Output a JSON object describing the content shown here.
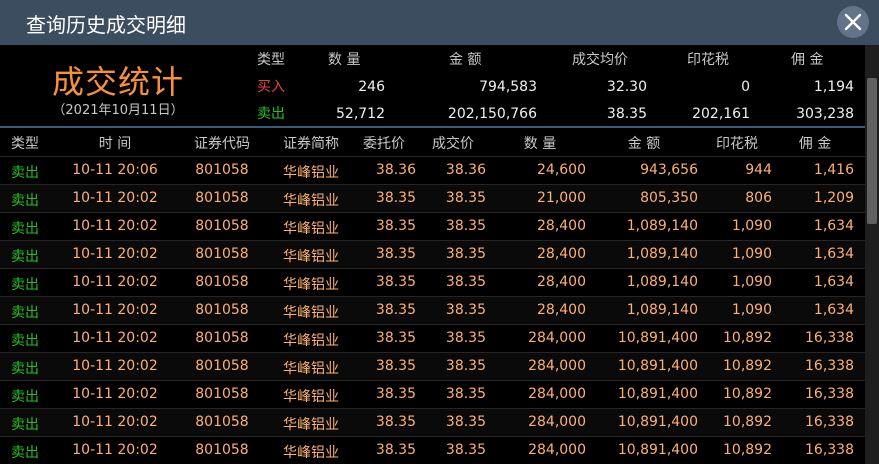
{
  "window": {
    "title": "查询历史成交明细",
    "close_icon": "close-icon"
  },
  "colors": {
    "titlebar": "#3c4d5f",
    "accent_orange": "#f7923a",
    "buy_red": "#e8413b",
    "sell_green": "#26c026",
    "cell_orange": "#ffb070",
    "divider_blue": "#3a5b80"
  },
  "summary": {
    "heading": "成交统计",
    "date": "（2021年10月11日）",
    "headers": [
      "类型",
      "数  量",
      "金  额",
      "成交均价",
      "印花税",
      "佣  金"
    ],
    "rows": [
      {
        "type": "买入",
        "qty": "246",
        "amount": "794,583",
        "avg": "32.30",
        "stamp": "0",
        "commission": "1,194"
      },
      {
        "type": "卖出",
        "qty": "52,712",
        "amount": "202,150,766",
        "avg": "38.35",
        "stamp": "202,161",
        "commission": "303,238"
      }
    ]
  },
  "table": {
    "headers": {
      "type": "类型",
      "time": "时  间",
      "code": "证券代码",
      "name": "证券简称",
      "order_price": "委托价",
      "deal_price": "成交价",
      "qty": "数  量",
      "amount": "金  额",
      "stamp": "印花税",
      "commission": "佣  金"
    },
    "rows": [
      {
        "type": "卖出",
        "time": "10-11 20:06",
        "code": "801058",
        "name": "华峰铝业",
        "order_price": "38.36",
        "deal_price": "38.36",
        "qty": "24,600",
        "amount": "943,656",
        "stamp": "944",
        "commission": "1,416"
      },
      {
        "type": "卖出",
        "time": "10-11 20:02",
        "code": "801058",
        "name": "华峰铝业",
        "order_price": "38.35",
        "deal_price": "38.35",
        "qty": "21,000",
        "amount": "805,350",
        "stamp": "806",
        "commission": "1,209"
      },
      {
        "type": "卖出",
        "time": "10-11 20:02",
        "code": "801058",
        "name": "华峰铝业",
        "order_price": "38.35",
        "deal_price": "38.35",
        "qty": "28,400",
        "amount": "1,089,140",
        "stamp": "1,090",
        "commission": "1,634"
      },
      {
        "type": "卖出",
        "time": "10-11 20:02",
        "code": "801058",
        "name": "华峰铝业",
        "order_price": "38.35",
        "deal_price": "38.35",
        "qty": "28,400",
        "amount": "1,089,140",
        "stamp": "1,090",
        "commission": "1,634"
      },
      {
        "type": "卖出",
        "time": "10-11 20:02",
        "code": "801058",
        "name": "华峰铝业",
        "order_price": "38.35",
        "deal_price": "38.35",
        "qty": "28,400",
        "amount": "1,089,140",
        "stamp": "1,090",
        "commission": "1,634"
      },
      {
        "type": "卖出",
        "time": "10-11 20:02",
        "code": "801058",
        "name": "华峰铝业",
        "order_price": "38.35",
        "deal_price": "38.35",
        "qty": "28,400",
        "amount": "1,089,140",
        "stamp": "1,090",
        "commission": "1,634"
      },
      {
        "type": "卖出",
        "time": "10-11 20:02",
        "code": "801058",
        "name": "华峰铝业",
        "order_price": "38.35",
        "deal_price": "38.35",
        "qty": "284,000",
        "amount": "10,891,400",
        "stamp": "10,892",
        "commission": "16,338"
      },
      {
        "type": "卖出",
        "time": "10-11 20:02",
        "code": "801058",
        "name": "华峰铝业",
        "order_price": "38.35",
        "deal_price": "38.35",
        "qty": "284,000",
        "amount": "10,891,400",
        "stamp": "10,892",
        "commission": "16,338"
      },
      {
        "type": "卖出",
        "time": "10-11 20:02",
        "code": "801058",
        "name": "华峰铝业",
        "order_price": "38.35",
        "deal_price": "38.35",
        "qty": "284,000",
        "amount": "10,891,400",
        "stamp": "10,892",
        "commission": "16,338"
      },
      {
        "type": "卖出",
        "time": "10-11 20:02",
        "code": "801058",
        "name": "华峰铝业",
        "order_price": "38.35",
        "deal_price": "38.35",
        "qty": "284,000",
        "amount": "10,891,400",
        "stamp": "10,892",
        "commission": "16,338"
      },
      {
        "type": "卖出",
        "time": "10-11 20:02",
        "code": "801058",
        "name": "华峰铝业",
        "order_price": "38.35",
        "deal_price": "38.35",
        "qty": "284,000",
        "amount": "10,891,400",
        "stamp": "10,892",
        "commission": "16,338"
      }
    ]
  }
}
